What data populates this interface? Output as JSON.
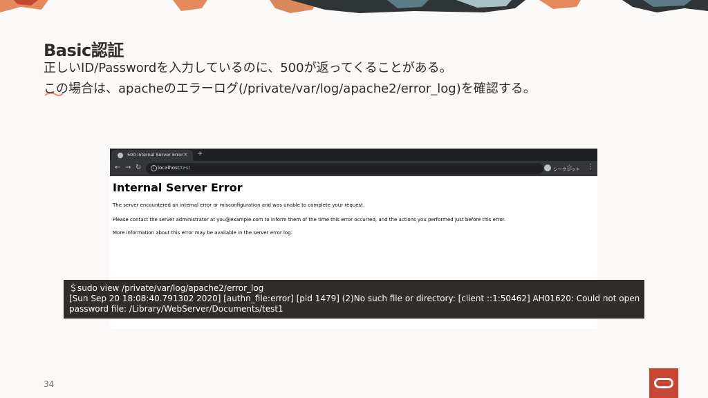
{
  "slide": {
    "title": "Basic認証",
    "line1": "正しいID/Passwordを入力しているのに、500が返ってくることがある。",
    "line2": "この場合は、apacheのエラーログ(/private/var/log/apache2/error_log)を確認する。",
    "page_number": "34"
  },
  "browser": {
    "tab_title": "500 Internal Server Error",
    "tab_close": "×",
    "new_tab": "+",
    "back": "←",
    "forward": "→",
    "reload": "↻",
    "info": "i",
    "url_host": "localhost",
    "url_path": "/test",
    "star": "☆",
    "incognito_label": "シークレット",
    "menu": "⋮"
  },
  "page": {
    "heading": "Internal Server Error",
    "para1": "The server encountered an internal error or misconfiguration and was unable to complete your request.",
    "para2": "Please contact the server administrator at you@example.com to inform them of the time this error occurred, and the actions you performed just before this error.",
    "para3": "More information about this error may be available in the server error log."
  },
  "terminal": {
    "line1": "＄sudo view /private/var/log/apache2/error_log",
    "line2": "[Sun Sep 20 18:08:40.791302 2020] [authn_file:error] [pid 1479] (2)No such file or directory: [client ::1:50462] AH01620: Could not open",
    "line3": "password file: /Library/WebServer/Documents/test1"
  },
  "colors": {
    "accent": "#c74634",
    "background": "#fbf9f8",
    "terminal_bg": "#312d2a"
  }
}
